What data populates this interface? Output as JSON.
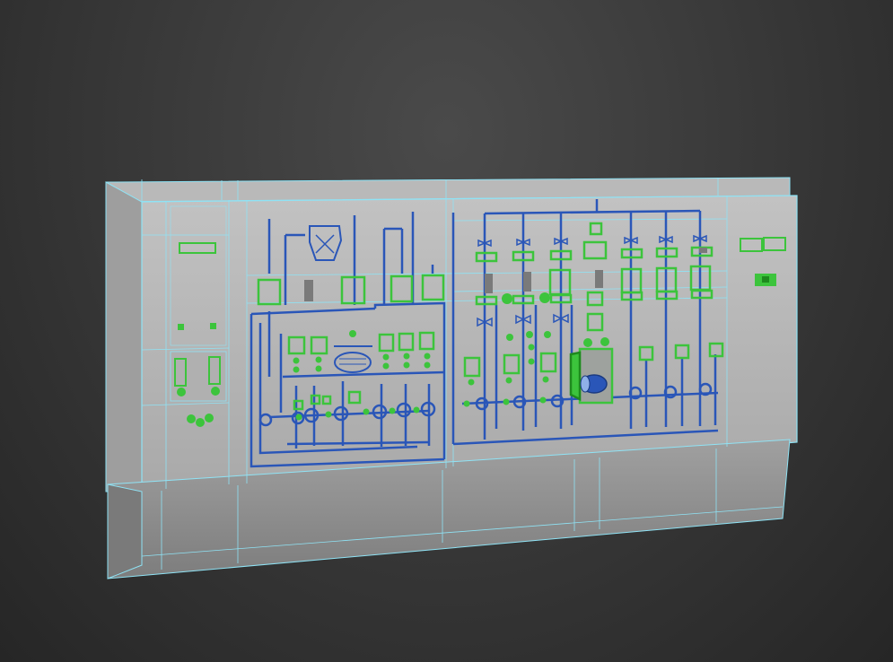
{
  "scene": {
    "colors": {
      "background_top": "#4a4a4a",
      "background_bottom": "#262626",
      "panel_face": "#b4b4b4",
      "panel_shadow": "#8a8a8a",
      "wireframe": "#8fe3f5",
      "schematic_line": "#2a56b8",
      "indicator": "#3cc43c",
      "indicator_dark": "#1e8a1e"
    },
    "objects": [
      {
        "name": "control-cabinet",
        "description_icon": "wireframe-box-icon"
      },
      {
        "name": "process-schematic",
        "description_icon": "pipe-diagram-icon"
      }
    ]
  }
}
